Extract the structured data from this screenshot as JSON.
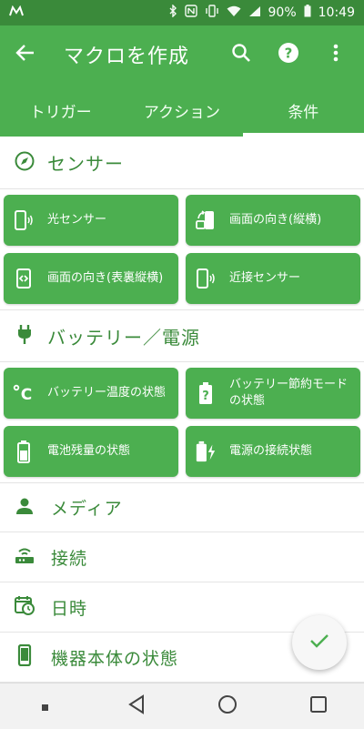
{
  "status_bar": {
    "battery": "90%",
    "time": "10:49"
  },
  "app_bar": {
    "title": "マクロを作成"
  },
  "tabs": [
    {
      "label": "トリガー"
    },
    {
      "label": "アクション"
    },
    {
      "label": "条件",
      "active": true
    }
  ],
  "sections": {
    "sensor": {
      "title": "センサー",
      "items": [
        {
          "label": "光センサー",
          "icon": "phone-light-icon"
        },
        {
          "label": "画面の向き(縦横)",
          "icon": "screen-rotation-icon"
        },
        {
          "label": "画面の向き(表裏縦横)",
          "icon": "screen-flip-icon"
        },
        {
          "label": "近接センサー",
          "icon": "phone-proximity-icon"
        }
      ]
    },
    "battery": {
      "title": "バッテリー／電源",
      "items": [
        {
          "label": "バッテリー温度の状態",
          "icon": "temperature-icon"
        },
        {
          "label": "バッテリー節約モードの状態",
          "icon": "battery-saver-icon"
        },
        {
          "label": "電池残量の状態",
          "icon": "battery-level-icon"
        },
        {
          "label": "電源の接続状態",
          "icon": "battery-charging-icon"
        }
      ]
    }
  },
  "collapsed_categories": [
    {
      "label": "メディア",
      "icon": "person-icon"
    },
    {
      "label": "接続",
      "icon": "router-icon"
    },
    {
      "label": "日時",
      "icon": "calendar-clock-icon"
    },
    {
      "label": "機器本体の状態",
      "icon": "smartphone-icon"
    }
  ],
  "colors": {
    "primary": "#4caf50",
    "primary_dark": "#3a8a3a",
    "status_bar": "#3a8a3a",
    "text_on_primary": "#ffffff"
  }
}
